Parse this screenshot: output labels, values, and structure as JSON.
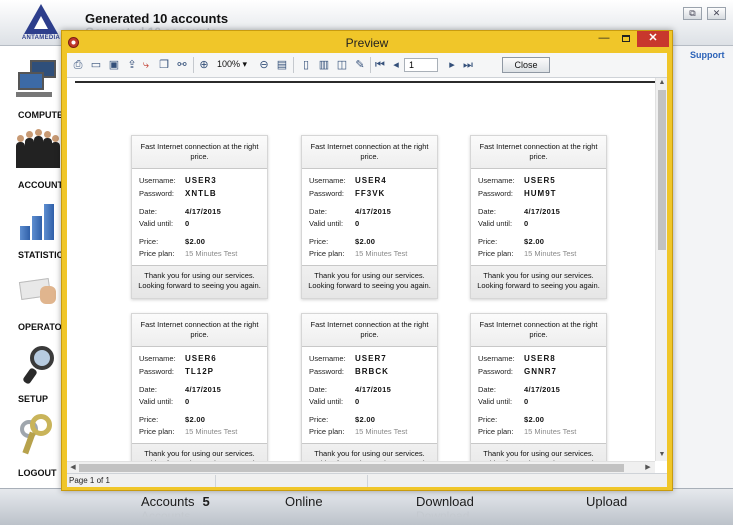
{
  "app": {
    "logo_text": "ANTAMEDIA",
    "title": "Generated 10 accounts",
    "support_label": "Support",
    "window_buttons": {
      "restore": "⧉",
      "close": "✕"
    }
  },
  "sidebar": {
    "items": [
      {
        "label": "COMPUTERS",
        "icon": "computers-icon"
      },
      {
        "label": "ACCOUNTS",
        "icon": "people-icon"
      },
      {
        "label": "STATISTICS",
        "icon": "bar-chart-icon"
      },
      {
        "label": "OPERATORS",
        "icon": "card-hand-icon"
      },
      {
        "label": "SETUP",
        "icon": "magnifier-icon"
      },
      {
        "label": "LOGOUT",
        "icon": "keys-icon"
      }
    ]
  },
  "footer": {
    "accounts_label": "Accounts",
    "accounts_count": "5",
    "online_label": "Online",
    "download_label": "Download",
    "upload_label": "Upload"
  },
  "preview": {
    "title": "Preview",
    "controls": {
      "minimize": "—",
      "close": "✕"
    },
    "toolbar": {
      "icons": [
        "print-icon",
        "open-icon",
        "save-icon",
        "export-icon",
        "pdf-icon",
        "copy-icon",
        "find-icon",
        "zoom-in-icon",
        "zoom-out-icon",
        "fit-page-icon",
        "single-page-icon",
        "multi-page-icon",
        "two-page-icon",
        "edit-icon",
        "first-page-icon",
        "prev-page-icon",
        "next-page-icon",
        "last-page-icon"
      ],
      "zoom": "100%",
      "page": "1",
      "close_label": "Close"
    },
    "status": "Page 1 of 1",
    "colors": {
      "frame": "#f0c629",
      "close": "#c8372d"
    }
  },
  "vouchers": {
    "header": "Fast Internet connection at the right price.",
    "labels": {
      "username": "Username:",
      "password": "Password:",
      "date": "Date:",
      "valid_until": "Valid until:",
      "price": "Price:",
      "price_plan": "Price plan:"
    },
    "footer": "Thank you for using our services. Looking forward to seeing you again.",
    "cards": [
      {
        "username": "USER3",
        "password": "XNTLB",
        "date": "4/17/2015",
        "valid_until": "0",
        "price": "$2.00",
        "price_plan": "15 Minutes Test"
      },
      {
        "username": "USER4",
        "password": "FF3VK",
        "date": "4/17/2015",
        "valid_until": "0",
        "price": "$2.00",
        "price_plan": "15 Minutes Test"
      },
      {
        "username": "USER5",
        "password": "HUM9T",
        "date": "4/17/2015",
        "valid_until": "0",
        "price": "$2.00",
        "price_plan": "15 Minutes Test"
      },
      {
        "username": "USER6",
        "password": "TL12P",
        "date": "4/17/2015",
        "valid_until": "0",
        "price": "$2.00",
        "price_plan": "15 Minutes Test"
      },
      {
        "username": "USER7",
        "password": "BRBCK",
        "date": "4/17/2015",
        "valid_until": "0",
        "price": "$2.00",
        "price_plan": "15 Minutes Test"
      },
      {
        "username": "USER8",
        "password": "GNNR7",
        "date": "4/17/2015",
        "valid_until": "0",
        "price": "$2.00",
        "price_plan": "15 Minutes Test"
      }
    ]
  }
}
